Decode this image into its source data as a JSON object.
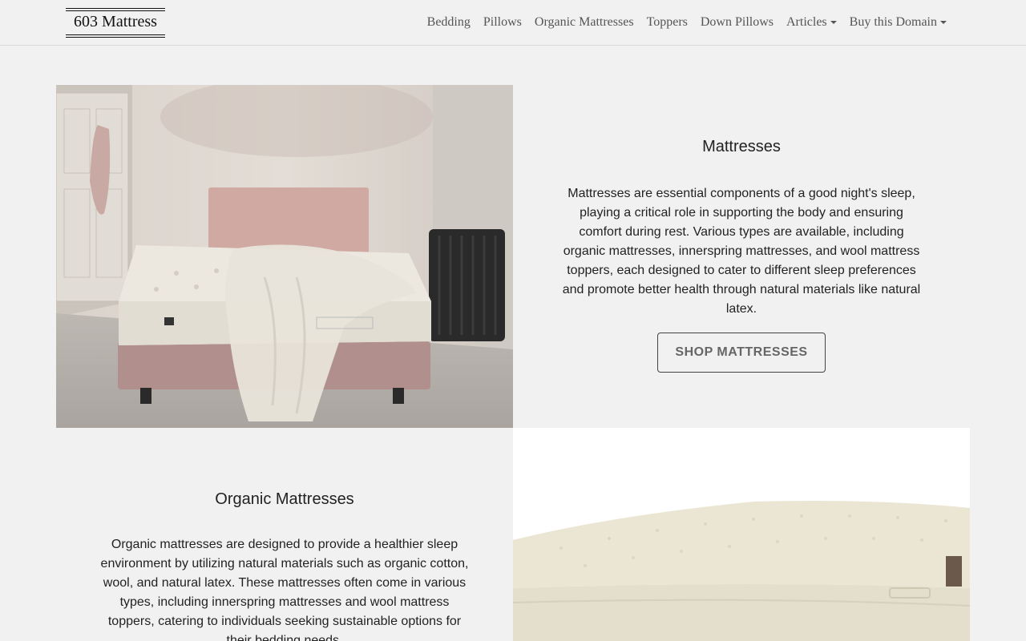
{
  "brand": {
    "name": "603 Mattress"
  },
  "nav": {
    "items": [
      {
        "label": "Bedding",
        "dropdown": false
      },
      {
        "label": "Pillows",
        "dropdown": false
      },
      {
        "label": "Organic Mattresses",
        "dropdown": false
      },
      {
        "label": "Toppers",
        "dropdown": false
      },
      {
        "label": "Down Pillows",
        "dropdown": false
      },
      {
        "label": "Articles",
        "dropdown": true
      },
      {
        "label": "Buy this Domain",
        "dropdown": true
      }
    ]
  },
  "sections": [
    {
      "title": "Mattresses",
      "body": "Mattresses are essential components of a good night's sleep, playing a critical role in supporting the body and ensuring comfort during rest. Various types are available, including organic mattresses, innerspring mattresses, and wool mattress toppers, each designed to cater to different sleep preferences and promote better health through natural materials like natural latex.",
      "button_label": "SHOP MATTRESSES",
      "image": "bedroom-mattress-photo"
    },
    {
      "title": "Organic Mattresses",
      "body": "Organic mattresses are designed to provide a healthier sleep environment by utilizing natural materials such as organic cotton, wool, and natural latex. These mattresses often come in various types, including innerspring mattresses and wool mattress toppers, catering to individuals seeking sustainable options for their bedding needs.",
      "image": "organic-mattress-photo"
    }
  ]
}
